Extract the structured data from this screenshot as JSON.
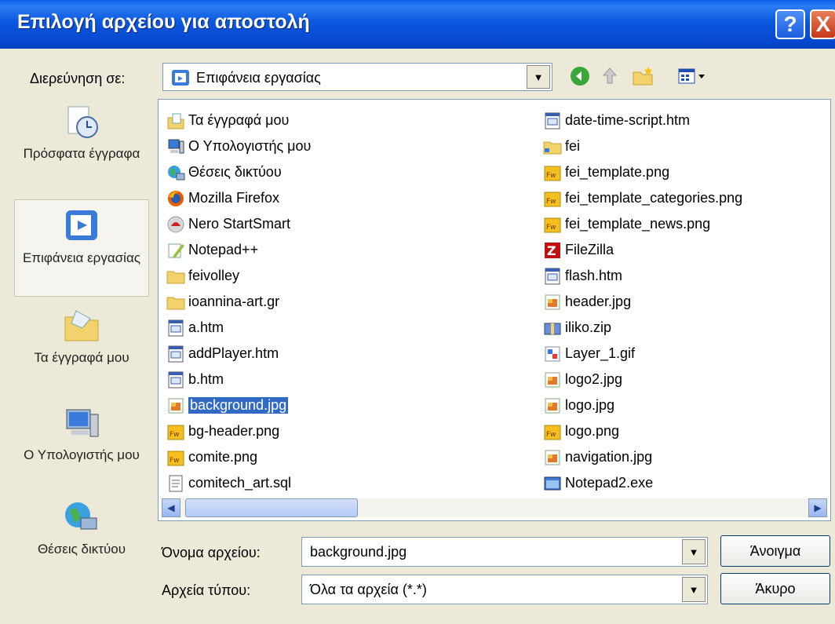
{
  "window": {
    "title": "Επιλογή αρχείου για αποστολή",
    "help": "?",
    "close": "X"
  },
  "lookin": {
    "label": "Διερεύνηση σε:",
    "value": "Επιφάνεια εργασίας"
  },
  "places": [
    {
      "label": "Πρόσφατα έγγραφα"
    },
    {
      "label": "Επιφάνεια εργασίας"
    },
    {
      "label": "Τα έγγραφά μου"
    },
    {
      "label": "Ο Υπολογιστής μου"
    },
    {
      "label": "Θέσεις δικτύου"
    }
  ],
  "files_left": [
    {
      "name": "Τα έγγραφά μου",
      "icon": "mydocs"
    },
    {
      "name": "Ο Υπολογιστής μου",
      "icon": "computer"
    },
    {
      "name": "Θέσεις δικτύου",
      "icon": "network"
    },
    {
      "name": "Mozilla Firefox",
      "icon": "firefox"
    },
    {
      "name": "Nero StartSmart",
      "icon": "nero"
    },
    {
      "name": "Notepad++",
      "icon": "notepadpp"
    },
    {
      "name": "feivolley",
      "icon": "folder"
    },
    {
      "name": "ioannina-art.gr",
      "icon": "folder"
    },
    {
      "name": "a.htm",
      "icon": "htm"
    },
    {
      "name": "addPlayer.htm",
      "icon": "htm"
    },
    {
      "name": "b.htm",
      "icon": "htm"
    },
    {
      "name": "background.jpg",
      "icon": "jpg"
    },
    {
      "name": "bg-header.png",
      "icon": "png"
    },
    {
      "name": "comite.png",
      "icon": "png"
    },
    {
      "name": "comitech_art.sql",
      "icon": "sql"
    }
  ],
  "files_right": [
    {
      "name": "date-time-script.htm",
      "icon": "htm"
    },
    {
      "name": "fei",
      "icon": "folder-shared"
    },
    {
      "name": "fei_template.png",
      "icon": "png"
    },
    {
      "name": "fei_template_categories.png",
      "icon": "png"
    },
    {
      "name": "fei_template_news.png",
      "icon": "png"
    },
    {
      "name": "FileZilla",
      "icon": "filezilla"
    },
    {
      "name": "flash.htm",
      "icon": "htm"
    },
    {
      "name": "header.jpg",
      "icon": "jpg"
    },
    {
      "name": "iliko.zip",
      "icon": "zip"
    },
    {
      "name": "Layer_1.gif",
      "icon": "gif"
    },
    {
      "name": "logo2.jpg",
      "icon": "jpg"
    },
    {
      "name": "logo.jpg",
      "icon": "jpg"
    },
    {
      "name": "logo.png",
      "icon": "png"
    },
    {
      "name": "navigation.jpg",
      "icon": "jpg"
    },
    {
      "name": "Notepad2.exe",
      "icon": "exe"
    }
  ],
  "filename": {
    "label": "Όνομα αρχείου:",
    "value": "background.jpg"
  },
  "filetype": {
    "label": "Αρχεία τύπου:",
    "value": "Όλα τα αρχεία (*.*)"
  },
  "buttons": {
    "open": "Άνοιγμα",
    "cancel": "Άκυρο"
  },
  "colors": {
    "titlebar": "#0a5fe9",
    "selection": "#316ac5",
    "face": "#ece9d8"
  }
}
